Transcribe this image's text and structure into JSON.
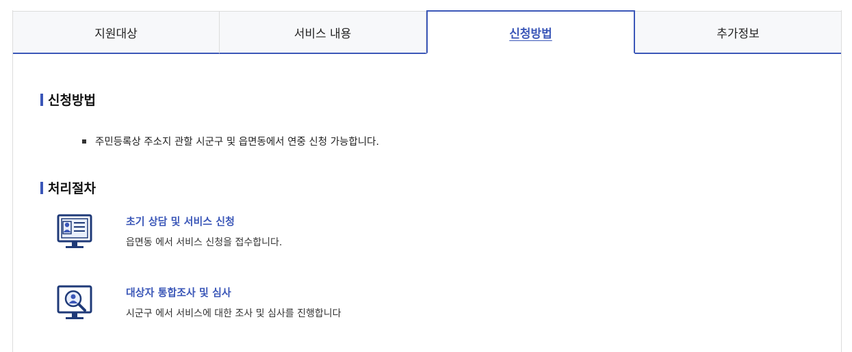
{
  "tabs": [
    {
      "label": "지원대상",
      "active": false
    },
    {
      "label": "서비스 내용",
      "active": false
    },
    {
      "label": "신청방법",
      "active": true
    },
    {
      "label": "추가정보",
      "active": false
    }
  ],
  "apply": {
    "title": "신청방법",
    "items": [
      "주민등록상 주소지 관할 시군구 및 읍면동에서 연중 신청 가능합니다."
    ]
  },
  "process": {
    "title": "처리절차",
    "steps": [
      {
        "title": "초기 상담 및 서비스 신청",
        "desc": "읍면동 에서 서비스 신청을 접수합니다.",
        "icon": "monitor-profile-icon"
      },
      {
        "title": "대상자 통합조사 및 심사",
        "desc": "시군구 에서 서비스에 대한 조사 및 심사를 진행합니다",
        "icon": "monitor-search-user-icon"
      }
    ]
  },
  "colors": {
    "accent": "#3b57b8",
    "navy": "#1f3a78"
  }
}
